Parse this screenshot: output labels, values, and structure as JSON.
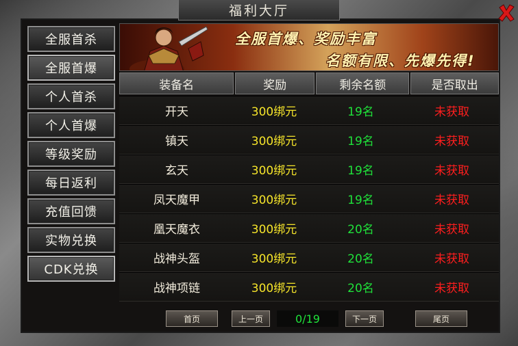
{
  "window": {
    "title": "福利大厅"
  },
  "sidebar": {
    "items": [
      {
        "label": "全服首杀"
      },
      {
        "label": "全服首爆"
      },
      {
        "label": "个人首杀"
      },
      {
        "label": "个人首爆"
      },
      {
        "label": "等级奖励"
      },
      {
        "label": "每日返利"
      },
      {
        "label": "充值回馈"
      },
      {
        "label": "实物兑换"
      },
      {
        "label": "CDK兑换"
      }
    ]
  },
  "banner": {
    "line1": "全服首爆、奖励丰富",
    "line2": "名额有限、先爆先得!"
  },
  "table": {
    "headers": [
      "装备名",
      "奖励",
      "剩余名额",
      "是否取出"
    ],
    "rows": [
      [
        "开天",
        "300绑元",
        "19名",
        "未获取"
      ],
      [
        "镇天",
        "300绑元",
        "19名",
        "未获取"
      ],
      [
        "玄天",
        "300绑元",
        "19名",
        "未获取"
      ],
      [
        "凤天魔甲",
        "300绑元",
        "19名",
        "未获取"
      ],
      [
        "凰天魔衣",
        "300绑元",
        "20名",
        "未获取"
      ],
      [
        "战神头盔",
        "300绑元",
        "20名",
        "未获取"
      ],
      [
        "战神项链",
        "300绑元",
        "20名",
        "未获取"
      ]
    ]
  },
  "pager": {
    "first": "首页",
    "prev": "上一页",
    "page": "0/19",
    "next": "下一页",
    "last": "尾页"
  },
  "icons": {
    "close": "close-icon"
  },
  "colors": {
    "reward": "#f6e52a",
    "remain": "#1fe23a",
    "status": "#ff1e1e",
    "close": "#d81818"
  }
}
